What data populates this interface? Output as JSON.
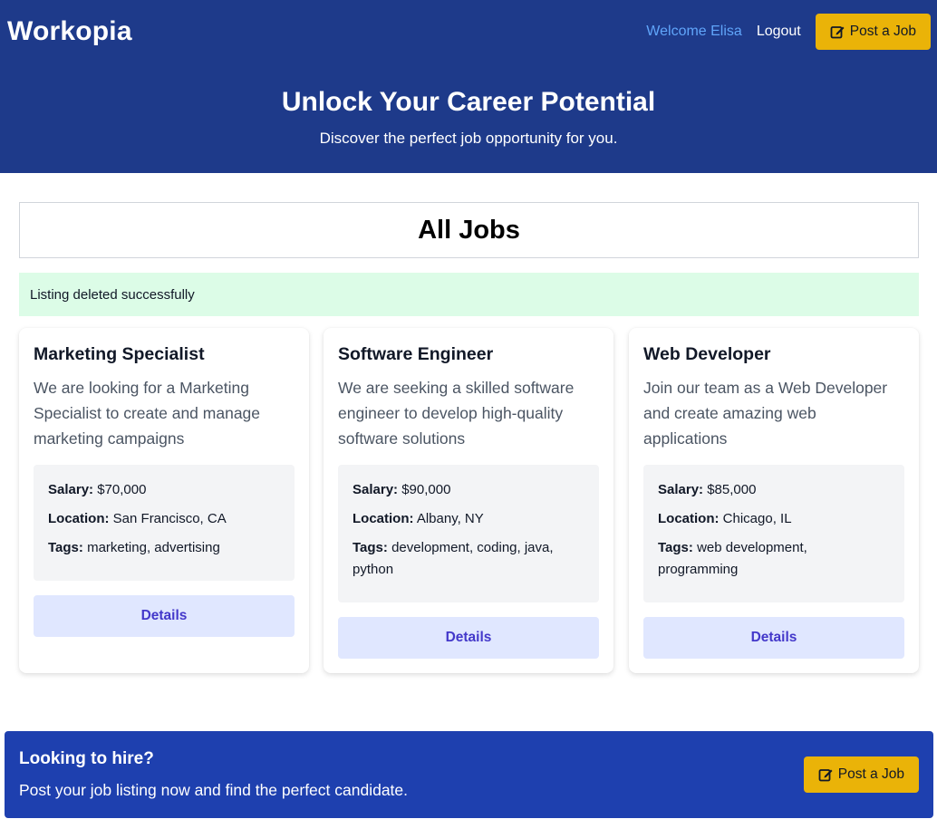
{
  "header": {
    "brand": "Workopia",
    "welcome": "Welcome Elisa",
    "logout": "Logout",
    "post_job": "Post a Job",
    "post_icon": "edit-icon"
  },
  "hero": {
    "title": "Unlock Your Career Potential",
    "subtitle": "Discover the perfect job opportunity for you."
  },
  "main": {
    "heading": "All Jobs",
    "alert": "Listing deleted successfully"
  },
  "labels": {
    "salary": "Salary:",
    "location": "Location:",
    "tags": "Tags:",
    "details": "Details"
  },
  "jobs": [
    {
      "title": "Marketing Specialist",
      "description": "We are looking for a Marketing Specialist to create and manage marketing campaigns",
      "salary": "$70,000",
      "location": "San Francisco, CA",
      "tags": "marketing, advertising"
    },
    {
      "title": "Software Engineer",
      "description": "We are seeking a skilled software engineer to develop high-quality software solutions",
      "salary": "$90,000",
      "location": "Albany, NY",
      "tags": "development, coding, java, python"
    },
    {
      "title": "Web Developer",
      "description": "Join our team as a Web Developer and create amazing web applications",
      "salary": "$85,000",
      "location": "Chicago, IL",
      "tags": "web development, programming"
    }
  ],
  "banner": {
    "title": "Looking to hire?",
    "text": "Post your job listing now and find the perfect candidate.",
    "post_job": "Post a Job"
  },
  "colors": {
    "header_bg": "#1e3a8a",
    "banner_bg": "#1e40af",
    "accent_yellow": "#eab308",
    "welcome_text": "#60a5fa",
    "alert_bg": "#dcfce7",
    "details_bg": "#e0e7ff",
    "details_text": "#4338ca"
  }
}
